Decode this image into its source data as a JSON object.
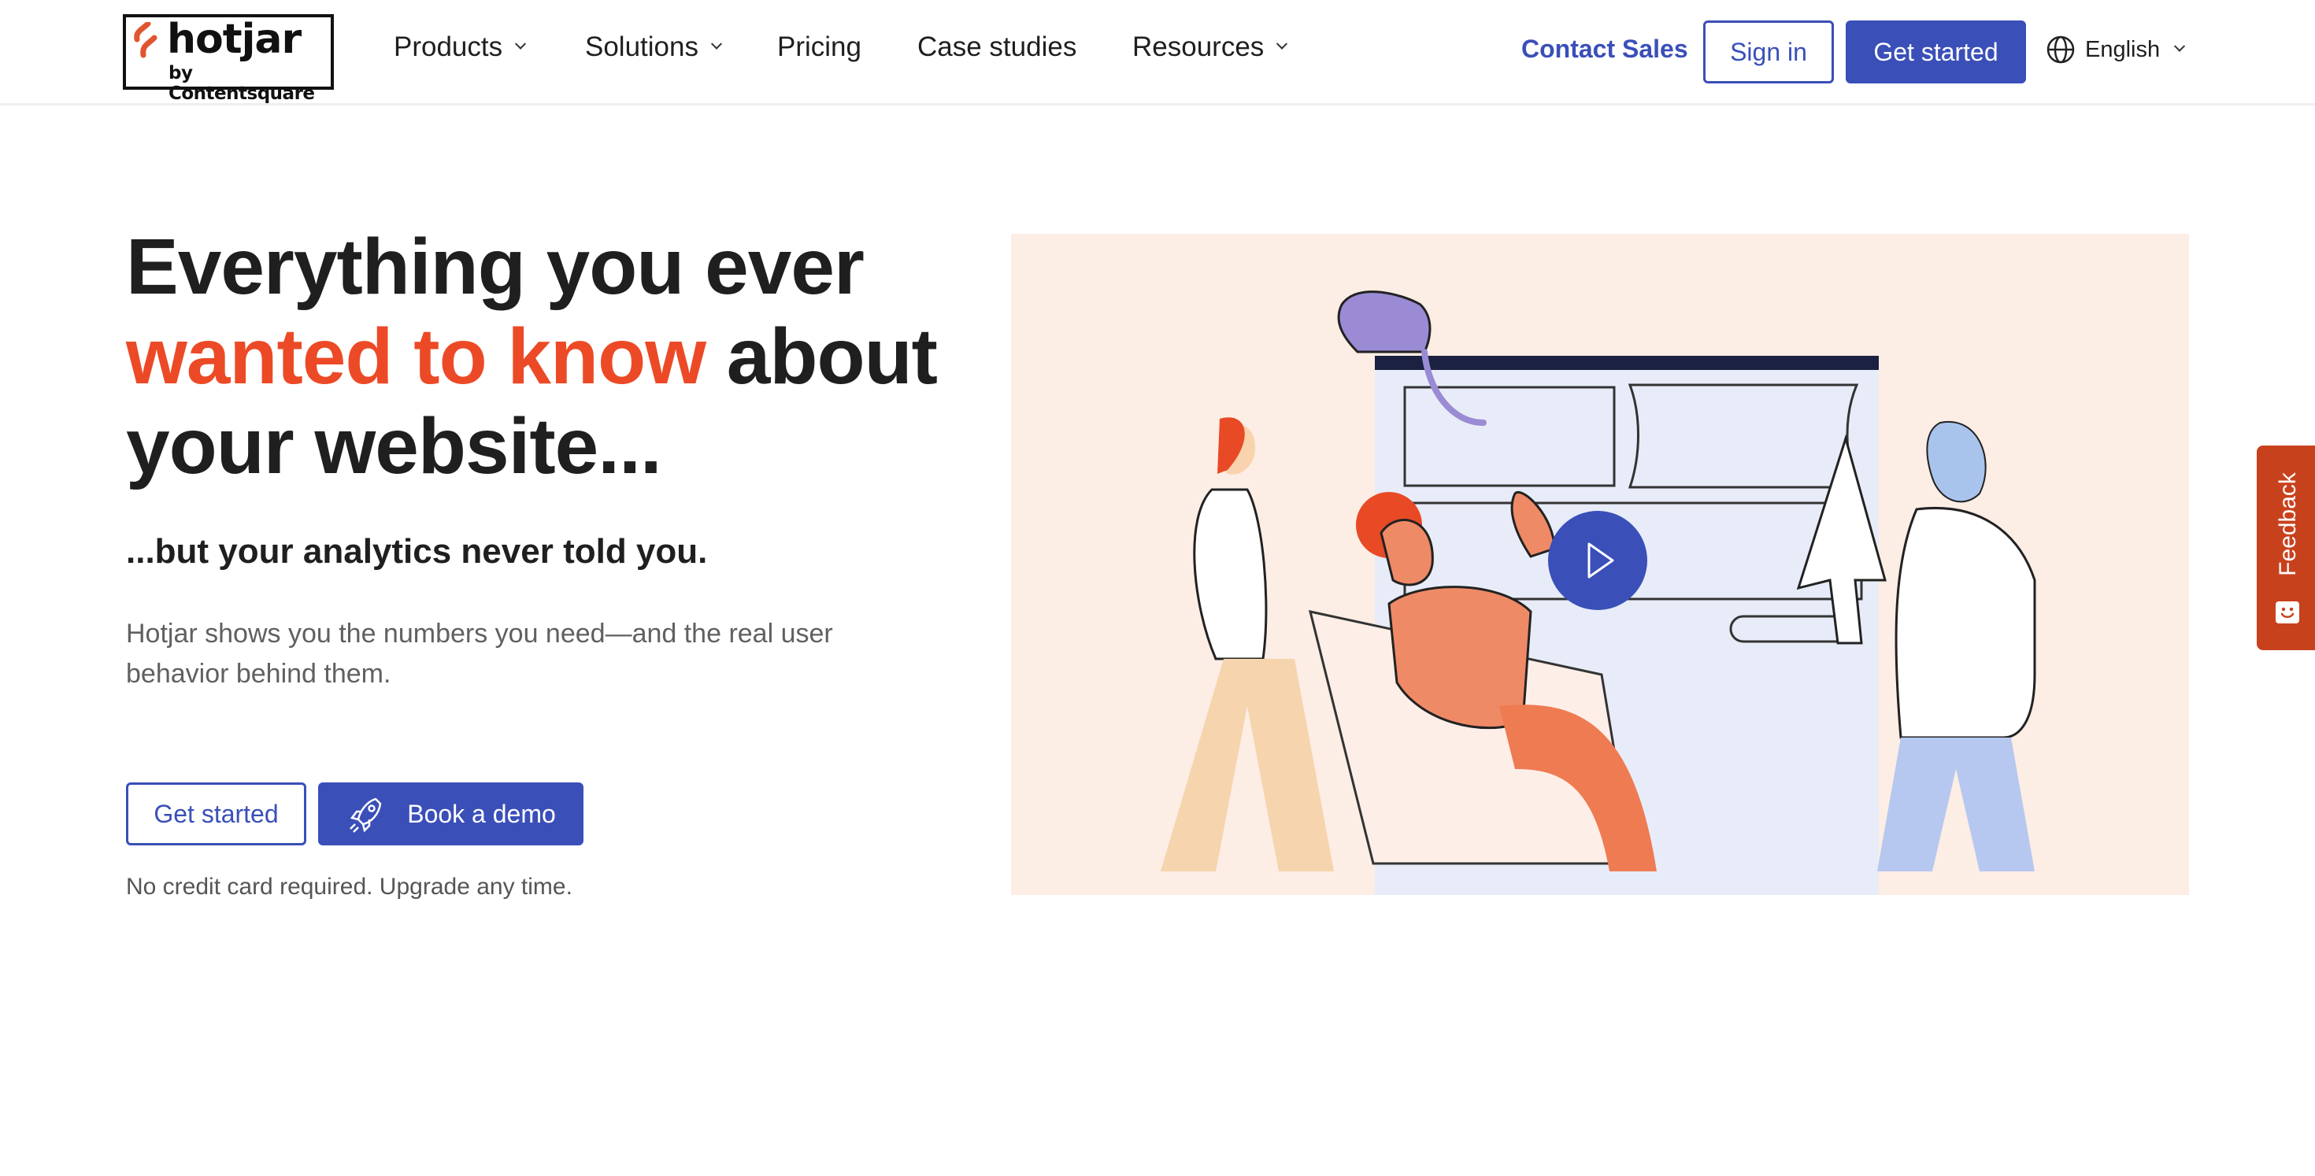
{
  "brand": {
    "name": "hotjar",
    "byline": "by Contentsquare",
    "accent_color": "#ec4a26",
    "primary_color": "#3a4fb8"
  },
  "nav": {
    "items": [
      {
        "label": "Products",
        "has_dropdown": true
      },
      {
        "label": "Solutions",
        "has_dropdown": true
      },
      {
        "label": "Pricing",
        "has_dropdown": false
      },
      {
        "label": "Case studies",
        "has_dropdown": false
      },
      {
        "label": "Resources",
        "has_dropdown": true
      }
    ],
    "contact_sales": "Contact Sales",
    "sign_in": "Sign in",
    "get_started": "Get started",
    "language": "English"
  },
  "hero": {
    "title_part1": "Everything you ever",
    "title_accent": "wanted to know",
    "title_part2": "about your website...",
    "subtitle": "...but your analytics never told you.",
    "body": "Hotjar shows you the numbers you need—and the real user behavior behind them.",
    "cta_primary": "Get started",
    "cta_secondary": "Book a demo",
    "note": "No credit card required. Upgrade any time."
  },
  "illustration": {
    "description": "People looking at a website wireframe with a cat on top",
    "play_button": "play-video"
  },
  "feedback": {
    "label": "Feedback"
  }
}
